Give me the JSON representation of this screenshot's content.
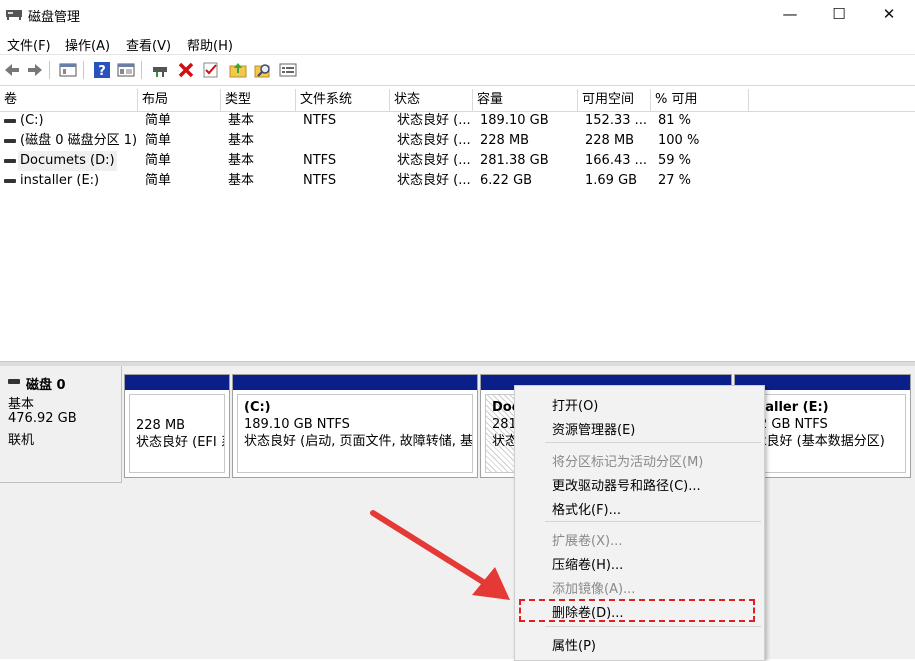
{
  "window": {
    "title": "磁盘管理",
    "minimize_glyph": "—",
    "maximize_glyph": "☐",
    "close_glyph": "✕"
  },
  "menu": [
    "文件(F)",
    "操作(A)",
    "查看(V)",
    "帮助(H)"
  ],
  "toolbar_icons": [
    "back-icon",
    "forward-icon",
    "properties-pane-icon",
    "help-icon",
    "console-pane-icon",
    "disk-connect-icon",
    "delete-icon",
    "check-icon",
    "up-folder-icon",
    "search-icon",
    "list-icon"
  ],
  "table": {
    "columns": [
      "卷",
      "布局",
      "类型",
      "文件系统",
      "状态",
      "容量",
      "可用空间",
      "% 可用"
    ],
    "rows": [
      {
        "volume": "(C:)",
        "layout": "简单",
        "type": "基本",
        "fs": "NTFS",
        "status": "状态良好 (...",
        "capacity": "189.10 GB",
        "free": "152.33 ...",
        "pct": "81 %"
      },
      {
        "volume": "(磁盘 0 磁盘分区 1)",
        "layout": "简单",
        "type": "基本",
        "fs": "",
        "status": "状态良好 (...",
        "capacity": "228 MB",
        "free": "228 MB",
        "pct": "100 %"
      },
      {
        "volume": "Documets (D:)",
        "layout": "简单",
        "type": "基本",
        "fs": "NTFS",
        "status": "状态良好 (...",
        "capacity": "281.38 GB",
        "free": "166.43 ...",
        "pct": "59 %"
      },
      {
        "volume": "installer (E:)",
        "layout": "简单",
        "type": "基本",
        "fs": "NTFS",
        "status": "状态良好 (...",
        "capacity": "6.22 GB",
        "free": "1.69 GB",
        "pct": "27 %"
      }
    ]
  },
  "disk": {
    "name": "磁盘 0",
    "type": "基本",
    "size": "476.92 GB",
    "state": "联机",
    "partitions": [
      {
        "title": "",
        "line1": "228 MB",
        "line2": "状态良好 (EFI 系"
      },
      {
        "title": "(C:)",
        "line1": "189.10 GB NTFS",
        "line2": "状态良好 (启动, 页面文件, 故障转储, 基2"
      },
      {
        "title": "Doc",
        "line1": "281.",
        "line2": "状态"
      },
      {
        "title": "taller  (E:)",
        "line1": "2 GB NTFS",
        "line2": "k良好 (基本数据分区)"
      }
    ]
  },
  "context_menu": {
    "items": [
      {
        "label": "打开(O)",
        "enabled": true
      },
      {
        "label": "资源管理器(E)",
        "enabled": true
      },
      {
        "label": "将分区标记为活动分区(M)",
        "enabled": false
      },
      {
        "label": "更改驱动器号和路径(C)...",
        "enabled": true
      },
      {
        "label": "格式化(F)...",
        "enabled": true
      },
      {
        "label": "扩展卷(X)...",
        "enabled": false
      },
      {
        "label": "压缩卷(H)...",
        "enabled": true
      },
      {
        "label": "添加镜像(A)...",
        "enabled": false
      },
      {
        "label": "删除卷(D)...",
        "enabled": true
      },
      {
        "label": "属性(P)",
        "enabled": true
      }
    ]
  },
  "colors": {
    "partition_bar": "#0a1f8a",
    "annotation": "#e53935"
  }
}
